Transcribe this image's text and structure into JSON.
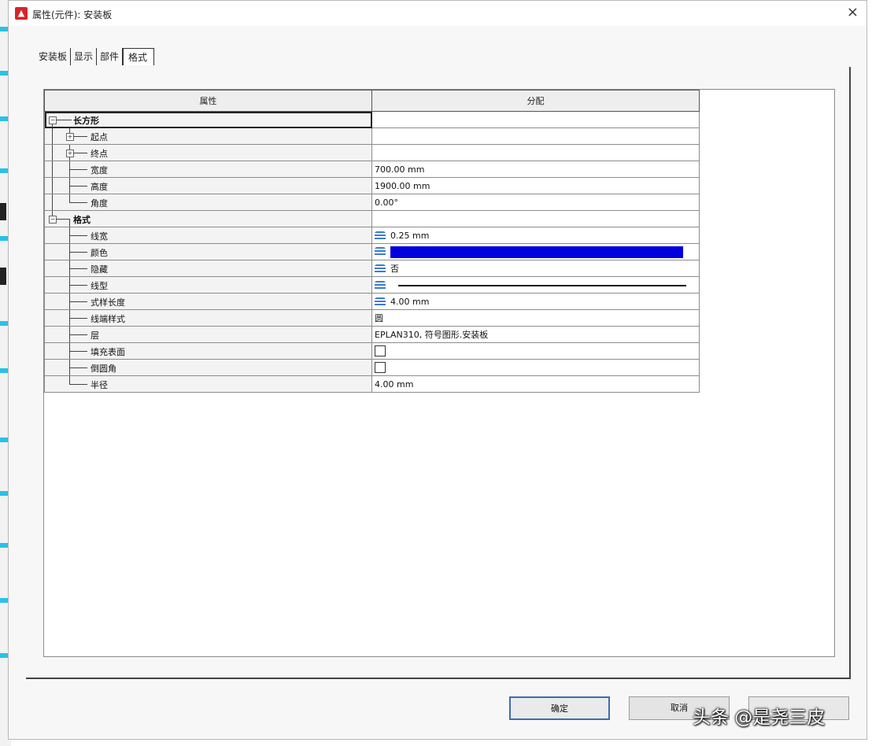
{
  "window": {
    "title": "属性(元件): 安装板",
    "close_label": "×"
  },
  "tabs": [
    "安装板",
    "显示",
    "部件",
    "格式"
  ],
  "active_tab": 3,
  "table": {
    "headers": [
      "属性",
      "分配"
    ],
    "rows": [
      {
        "name": "长方形",
        "value": ""
      },
      {
        "name": "起点",
        "value": ""
      },
      {
        "name": "终点",
        "value": ""
      },
      {
        "name": "宽度",
        "value": "700.00 mm"
      },
      {
        "name": "高度",
        "value": "1900.00 mm"
      },
      {
        "name": "角度",
        "value": "0.00°"
      },
      {
        "name": "格式",
        "value": ""
      },
      {
        "name": "线宽",
        "value": "0.25 mm"
      },
      {
        "name": "颜色",
        "value": ""
      },
      {
        "name": "隐藏",
        "value": "否"
      },
      {
        "name": "线型",
        "value": ""
      },
      {
        "name": "式样长度",
        "value": "4.00 mm"
      },
      {
        "name": "线端样式",
        "value": "圆"
      },
      {
        "name": "层",
        "value": "EPLAN310, 符号图形.安装板"
      },
      {
        "name": "填充表面",
        "value": ""
      },
      {
        "name": "倒圆角",
        "value": ""
      },
      {
        "name": "半径",
        "value": "4.00 mm"
      }
    ],
    "color_value": "#0000dd",
    "icons": {
      "row_7": "layer-stack-icon",
      "row_8": "layer-stack-icon",
      "row_9": "layer-stack-icon",
      "row_10": "layer-stack-icon",
      "row_11": "layer-stack-icon"
    }
  },
  "buttons": {
    "ok": "确定",
    "cancel": "取消"
  },
  "watermark": "头条 @是尧三皮"
}
